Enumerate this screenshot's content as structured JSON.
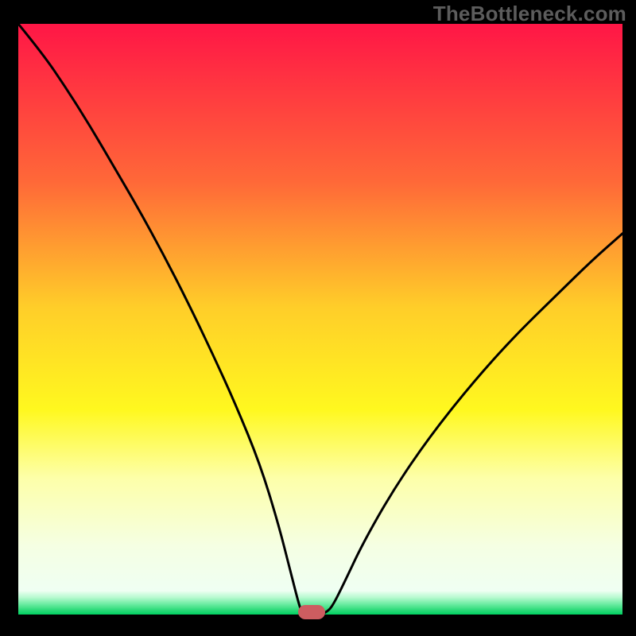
{
  "watermark": "TheBottleneck.com",
  "chart_data": {
    "type": "line",
    "title": "",
    "xlabel": "",
    "ylabel": "",
    "xlim": [
      0,
      100
    ],
    "ylim": [
      0,
      100
    ],
    "grid": false,
    "marker": {
      "x": 48.5,
      "y": 0,
      "color": "#cd5d60"
    },
    "curve": [
      {
        "x": 0.0,
        "y": 100.0
      },
      {
        "x": 4.0,
        "y": 95.0
      },
      {
        "x": 8.0,
        "y": 89.0
      },
      {
        "x": 12.0,
        "y": 82.5
      },
      {
        "x": 16.0,
        "y": 75.5
      },
      {
        "x": 20.0,
        "y": 68.5
      },
      {
        "x": 24.0,
        "y": 61.0
      },
      {
        "x": 28.0,
        "y": 53.0
      },
      {
        "x": 32.0,
        "y": 44.5
      },
      {
        "x": 36.0,
        "y": 35.5
      },
      {
        "x": 40.0,
        "y": 25.5
      },
      {
        "x": 43.0,
        "y": 15.5
      },
      {
        "x": 45.0,
        "y": 7.5
      },
      {
        "x": 46.5,
        "y": 1.5
      },
      {
        "x": 47.0,
        "y": 0.3
      },
      {
        "x": 48.0,
        "y": 0.0
      },
      {
        "x": 50.0,
        "y": 0.0
      },
      {
        "x": 51.0,
        "y": 0.4
      },
      {
        "x": 52.0,
        "y": 1.4
      },
      {
        "x": 54.0,
        "y": 5.5
      },
      {
        "x": 57.0,
        "y": 12.0
      },
      {
        "x": 62.0,
        "y": 21.0
      },
      {
        "x": 68.0,
        "y": 30.0
      },
      {
        "x": 75.0,
        "y": 39.0
      },
      {
        "x": 82.0,
        "y": 47.0
      },
      {
        "x": 89.0,
        "y": 54.0
      },
      {
        "x": 95.0,
        "y": 60.0
      },
      {
        "x": 100.0,
        "y": 64.5
      }
    ],
    "gradient_stops": [
      {
        "offset": 0,
        "color": "#ff1646"
      },
      {
        "offset": 28,
        "color": "#ff6938"
      },
      {
        "offset": 50,
        "color": "#ffce29"
      },
      {
        "offset": 68,
        "color": "#fff81f"
      },
      {
        "offset": 80,
        "color": "#fdffa9"
      },
      {
        "offset": 92,
        "color": "#f5ffe3"
      },
      {
        "offset": 100,
        "color": "#effff3"
      }
    ],
    "green_band_stops": [
      {
        "offset": 0,
        "color": "#e7ffee"
      },
      {
        "offset": 25,
        "color": "#b9fad1"
      },
      {
        "offset": 55,
        "color": "#6ceca2"
      },
      {
        "offset": 80,
        "color": "#2edb7a"
      },
      {
        "offset": 100,
        "color": "#00d061"
      }
    ]
  }
}
